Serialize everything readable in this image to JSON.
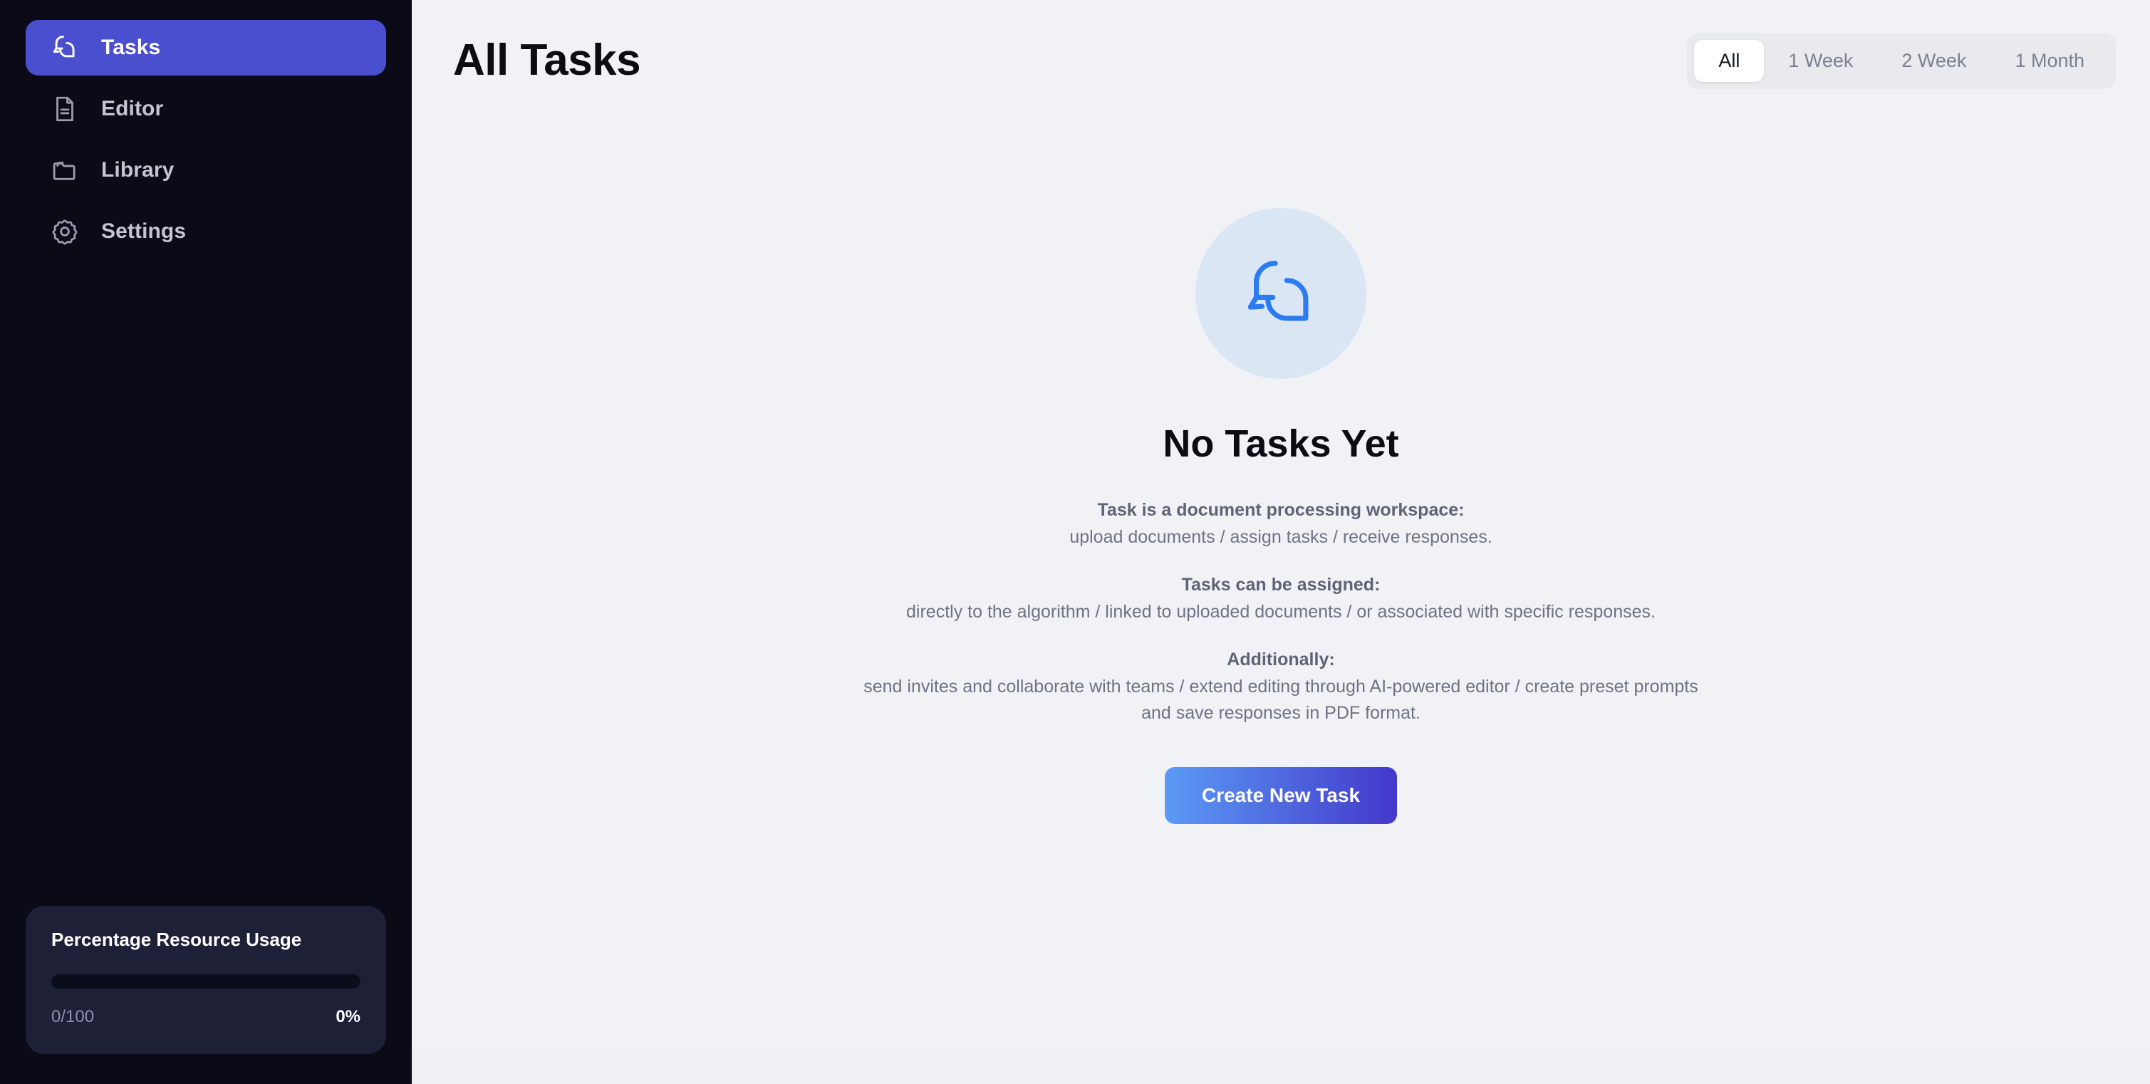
{
  "sidebar": {
    "items": [
      {
        "label": "Tasks",
        "icon": "chat-bubbles-icon",
        "active": true
      },
      {
        "label": "Editor",
        "icon": "document-icon",
        "active": false
      },
      {
        "label": "Library",
        "icon": "folder-icon",
        "active": false
      },
      {
        "label": "Settings",
        "icon": "gear-icon",
        "active": false
      }
    ],
    "resource_card": {
      "title": "Percentage Resource Usage",
      "used_label": "0/100",
      "percent_label": "0%",
      "percent_value": 0
    }
  },
  "header": {
    "title": "All Tasks",
    "filters": [
      {
        "label": "All",
        "active": true
      },
      {
        "label": "1 Week",
        "active": false
      },
      {
        "label": "2 Week",
        "active": false
      },
      {
        "label": "1 Month",
        "active": false
      }
    ]
  },
  "empty_state": {
    "icon": "chat-bubbles-icon",
    "title": "No Tasks Yet",
    "paragraphs": [
      {
        "heading": "Task is a document processing workspace:",
        "text": "upload documents / assign tasks / receive responses."
      },
      {
        "heading": "Tasks can be assigned:",
        "text": "directly to the algorithm / linked to uploaded documents / or associated with specific responses."
      },
      {
        "heading": "Additionally:",
        "text": "send invites and collaborate with teams / extend editing through AI-powered editor / create preset prompts and save responses in PDF format."
      }
    ],
    "cta_label": "Create New Task"
  },
  "colors": {
    "sidebar_bg": "#0a0b16",
    "active_nav": "#4a4fd0",
    "card_bg": "#1e2037",
    "main_bg": "#f1f2f5",
    "accent_blue": "#2b7cf0",
    "icon_circle": "#dbe6f5",
    "cta_gradient_from": "#5b9bf5",
    "cta_gradient_to": "#4338ca"
  }
}
